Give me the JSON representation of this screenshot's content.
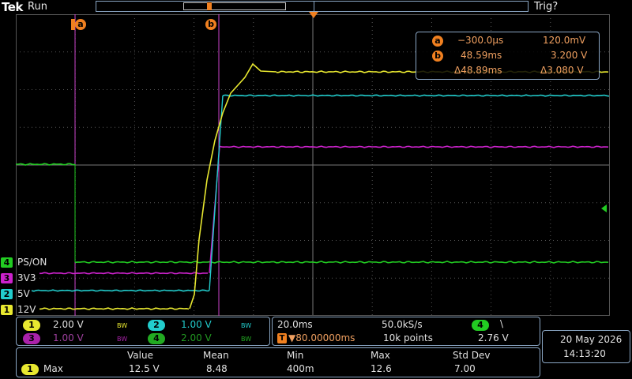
{
  "header": {
    "brand": "Tek",
    "run_state": "Run",
    "trigger_state": "Trig?"
  },
  "cursors": {
    "a_label": "a",
    "b_label": "b"
  },
  "cursor_readout": {
    "a_time": "−300.0µs",
    "a_value": "120.0mV",
    "b_time": "48.59ms",
    "b_value": "3.200 V",
    "delta_time": "Δ48.89ms",
    "delta_value": "Δ3.080 V"
  },
  "trigger_marker_label": "T",
  "channels": [
    {
      "number": "4",
      "name": "PS/ON",
      "color": "#22cc22"
    },
    {
      "number": "3",
      "name": "3V3",
      "color": "#cc22cc"
    },
    {
      "number": "2",
      "name": "5V",
      "color": "#22cccc"
    },
    {
      "number": "1",
      "name": "12V",
      "color": "#e8e830"
    }
  ],
  "channel_settings": [
    {
      "number": "1",
      "scale": "2.00 V",
      "bw": "BW",
      "color": "#e8e830",
      "dim": false
    },
    {
      "number": "2",
      "scale": "1.00 V",
      "bw": "BW",
      "color": "#22cccc",
      "dim": false
    },
    {
      "number": "3",
      "scale": "1.00 V",
      "bw": "BW",
      "color": "#cc22cc",
      "dim": true
    },
    {
      "number": "4",
      "scale": "2.00 V",
      "bw": "BW",
      "color": "#22cc22",
      "dim": true
    }
  ],
  "timebase": {
    "scale": "20.0ms",
    "sample_rate": "50.0kS/s",
    "trigger_position": "▼80.00000ms",
    "record_length": "10k points",
    "trigger_channel": "4",
    "trigger_slope": "\\",
    "trigger_level": "2.76 V"
  },
  "datetime": {
    "date": "20 May  2026",
    "time": "14:13:20"
  },
  "measurement": {
    "headers": [
      "Value",
      "Mean",
      "Min",
      "Max",
      "Std Dev"
    ],
    "channel": "1",
    "name": "Max",
    "values": [
      "12.5 V",
      "8.48",
      "400m",
      "12.6",
      "7.00"
    ]
  },
  "waveform_colors": {
    "ch1": "#e8e830",
    "ch2": "#22cccc",
    "ch3": "#cc22cc",
    "ch4": "#22cc22",
    "cursor": "#cc44cc",
    "graticule": "#555555"
  }
}
